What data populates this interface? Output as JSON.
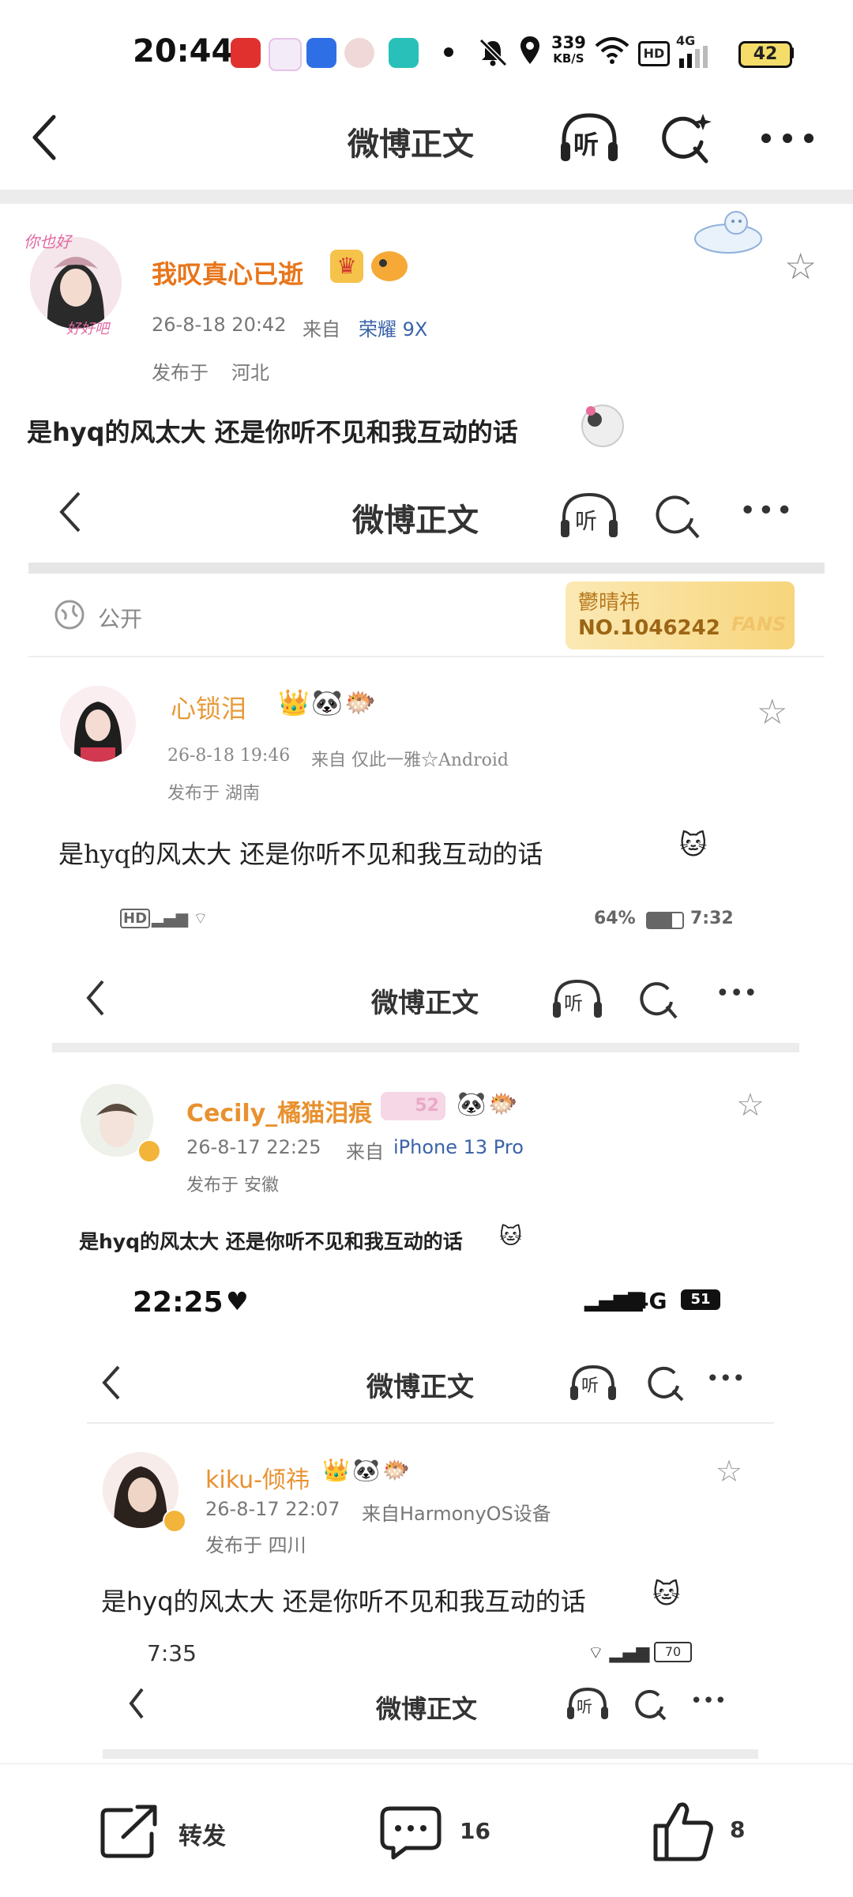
{
  "status_bar": {
    "time": "20:44",
    "net_speed_value": "339",
    "net_speed_unit": "KB/S",
    "hd": "HD",
    "network": "4G",
    "battery": "42"
  },
  "header": {
    "title": "微博正文",
    "listen_label": "听"
  },
  "post": {
    "username": "我叹真心已逝",
    "avatar_text_top": "你也好",
    "avatar_text_bottom": "好好吧",
    "time": "26-8-18 20:42",
    "source_prefix": "来自",
    "device": "荣耀 9X",
    "location_prefix": "发布于",
    "location": "河北",
    "text": "是hyq的风太大 还是你听不见和我互动的话"
  },
  "shot1": {
    "title": "微博正文",
    "listen_label": "听",
    "visibility": "公开",
    "fans_name": "鬱晴祎",
    "fans_no": "NO.1046242",
    "fans_tag": "FANS",
    "username": "心锁泪",
    "time": "26-8-18 19:46",
    "source": "来自 仅此一雅☆Android",
    "location": "发布于 湖南",
    "text": "是hyq的风太大 还是你听不见和我互动的话"
  },
  "shot2": {
    "status_left": "HD",
    "battery_text": "64%",
    "time": "7:32",
    "title": "微博正文",
    "listen_label": "听",
    "username": "Cecily_橘猫泪痕",
    "level": "52",
    "post_time": "26-8-17 22:25",
    "source_prefix": "来自",
    "device": "iPhone 13 Pro",
    "location": "发布于 安徽",
    "text": "是hyq的风太大 还是你听不见和我互动的话"
  },
  "shot3": {
    "time": "22:25",
    "network": "4G",
    "battery": "51",
    "title": "微博正文",
    "listen_label": "听",
    "username": "kiku-倾祎",
    "post_time": "26-8-17 22:07",
    "source": "来自HarmonyOS设备",
    "location": "发布于 四川",
    "text": "是hyq的风太大 还是你听不见和我互动的话"
  },
  "shot4": {
    "time": "7:35",
    "battery": "70",
    "title": "微博正文",
    "listen_label": "听"
  },
  "bottom_bar": {
    "repost_label": "转发",
    "comment_count": "16",
    "like_count": "8"
  },
  "colors": {
    "username_orange": "#e8751a",
    "device_blue": "#3a63a8",
    "divider": "#ececec"
  }
}
